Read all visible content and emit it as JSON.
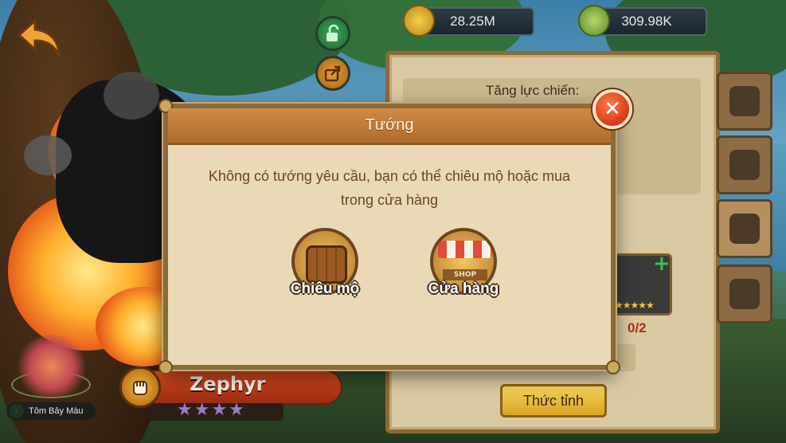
{
  "currency": {
    "gold": "28.25M",
    "leaf": "309.98K"
  },
  "panel": {
    "power_label": "Tăng lực chiến:",
    "progress_count": "0/2",
    "awaken_button": "Thức tỉnh"
  },
  "hero": {
    "name": "Zephyr",
    "stars": "★★★★",
    "pet_name": "Tôm Bảy Màu"
  },
  "dialog": {
    "title": "Tướng",
    "message": "Không có tướng yêu cầu, bạn có thể chiêu mộ hoặc mua trong cửa hàng",
    "close_label": "✕",
    "options": [
      {
        "label": "Chiêu mộ",
        "icon": "barrel-icon"
      },
      {
        "label": "Cửa hàng",
        "icon": "shop-icon",
        "sign": "SHOP"
      }
    ]
  },
  "card": {
    "stars": "★★★★★"
  },
  "colors": {
    "accent_red": "#d63a16",
    "parchment": "#ead9b7",
    "header_brown": "#b06c2e",
    "button_gold": "#f5d35a"
  }
}
